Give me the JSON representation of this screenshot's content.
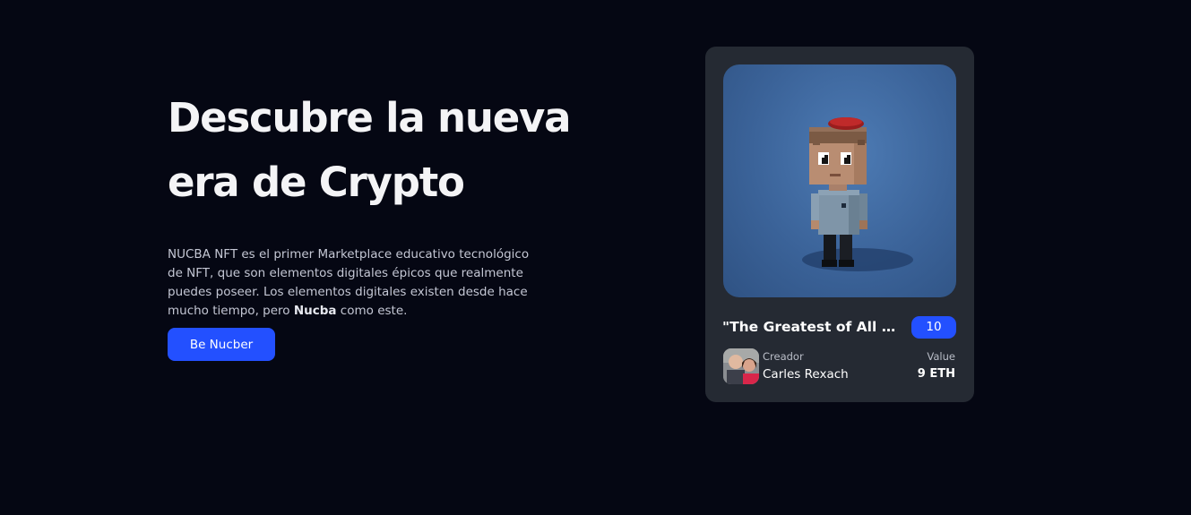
{
  "hero": {
    "title_line1": "Descubre la nueva",
    "title_line2": "era de Crypto",
    "description_part1": "NUCBA NFT es el primer Marketplace educativo tecnológico de NFT, que son elementos digitales épicos que realmente puedes poseer. Los elementos digitales existen desde hace mucho tiempo, pero ",
    "description_bold": "Nucba",
    "description_part2": " como este.",
    "cta_label": "Be Nucber"
  },
  "nft_card": {
    "title": "\"The Greatest of All Time\"",
    "badge": "10",
    "creator_label": "Creador",
    "creator_name": "Carles Rexach",
    "value_label": "Value",
    "value_amount": "9 ETH"
  },
  "colors": {
    "background": "#050713",
    "card": "#252a33",
    "accent": "#2350ff",
    "image_bg": "#3b6399"
  },
  "icons": {
    "nft_image": "voxel-character-image",
    "creator_avatar": "creator-avatar-photo"
  }
}
